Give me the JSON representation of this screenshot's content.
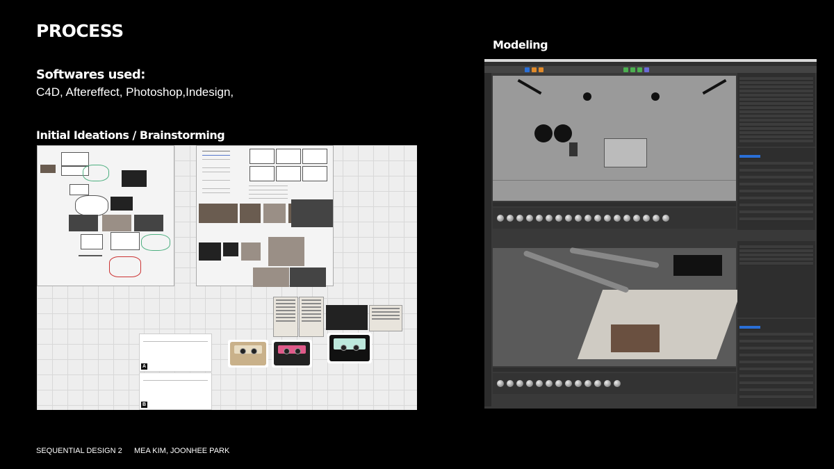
{
  "title": "PROCESS",
  "software": {
    "heading": "Softwares used:",
    "list": "C4D, Aftereffect, Photoshop,Indesign,"
  },
  "ideation": {
    "heading": "Initial Ideations / Brainstorming",
    "paper_a_tag": "A",
    "paper_b_tag": "B"
  },
  "modeling": {
    "heading": "Modeling"
  },
  "footer": {
    "course": "SEQUENTIAL DESIGN 2",
    "authors": "MEA KIM, JOONHEE PARK"
  },
  "colors": {
    "background": "#000000",
    "text": "#ffffff",
    "board": "#eeeeee",
    "c4d_ui": "#393939",
    "c4d_viewport": "#9a9a9a",
    "accent_orange": "#e08a2a",
    "accent_blue": "#2a6fd6"
  }
}
